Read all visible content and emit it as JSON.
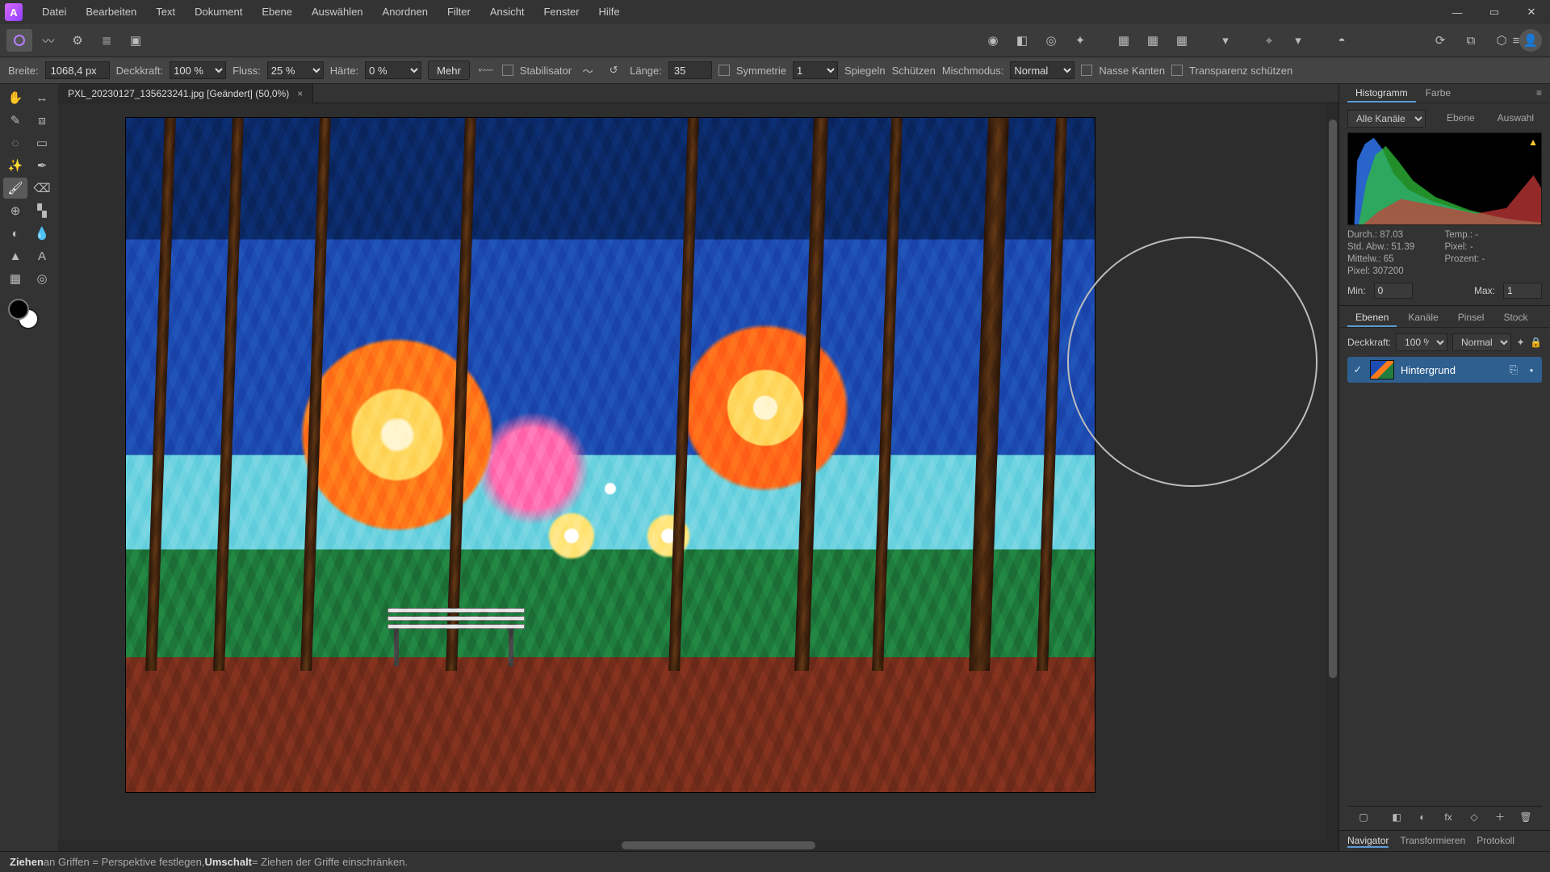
{
  "menu": {
    "items": [
      "Datei",
      "Bearbeiten",
      "Text",
      "Dokument",
      "Ebene",
      "Auswählen",
      "Anordnen",
      "Filter",
      "Ansicht",
      "Fenster",
      "Hilfe"
    ]
  },
  "window": {
    "minimize": "—",
    "maximize": "▭",
    "close": "✕"
  },
  "context": {
    "breite_label": "Breite:",
    "breite_val": "1068,4 px",
    "deck_label": "Deckkraft:",
    "deck_val": "100 %",
    "fluss_label": "Fluss:",
    "fluss_val": "25 %",
    "haerte_label": "Härte:",
    "haerte_val": "0 %",
    "mehr": "Mehr",
    "stabil": "Stabilisator",
    "laenge_label": "Länge:",
    "laenge_val": "35",
    "sym_label": "Symmetrie",
    "sym_val": "1",
    "spiegeln": "Spiegeln",
    "schuetzen": "Schützen",
    "misch_label": "Mischmodus:",
    "misch_val": "Normal",
    "nasse": "Nasse Kanten",
    "transp": "Transparenz schützen"
  },
  "document": {
    "tab": "PXL_20230127_135623241.jpg [Geändert] (50,0%)",
    "close": "×"
  },
  "histogram": {
    "tab1": "Histogramm",
    "tab2": "Farbe",
    "channel": "Alle Kanäle",
    "ebene": "Ebene",
    "auswahl": "Auswahl",
    "stats": {
      "durch": "Durch.: 87.03",
      "std": "Std. Abw.: 51.39",
      "mittel": "Mittelw.: 65",
      "pixel": "Pixel: 307200",
      "temp": "Temp.: -",
      "pixel2": "Pixel: -",
      "prozent": "Prozent: -"
    },
    "min_label": "Min:",
    "min_val": "0",
    "max_label": "Max:",
    "max_val": "1"
  },
  "layers": {
    "tabs": [
      "Ebenen",
      "Kanäle",
      "Pinsel",
      "Stock"
    ],
    "deck_label": "Deckkraft:",
    "deck_val": "100 %",
    "blend": "Normal",
    "item_name": "Hintergrund"
  },
  "nav": {
    "tabs": [
      "Navigator",
      "Transformieren",
      "Protokoll"
    ]
  },
  "status": {
    "pre": "Ziehen",
    "mid": " an Griffen = Perspektive festlegen, ",
    "key": "Umschalt",
    "post": " = Ziehen der Griffe einschränken."
  }
}
